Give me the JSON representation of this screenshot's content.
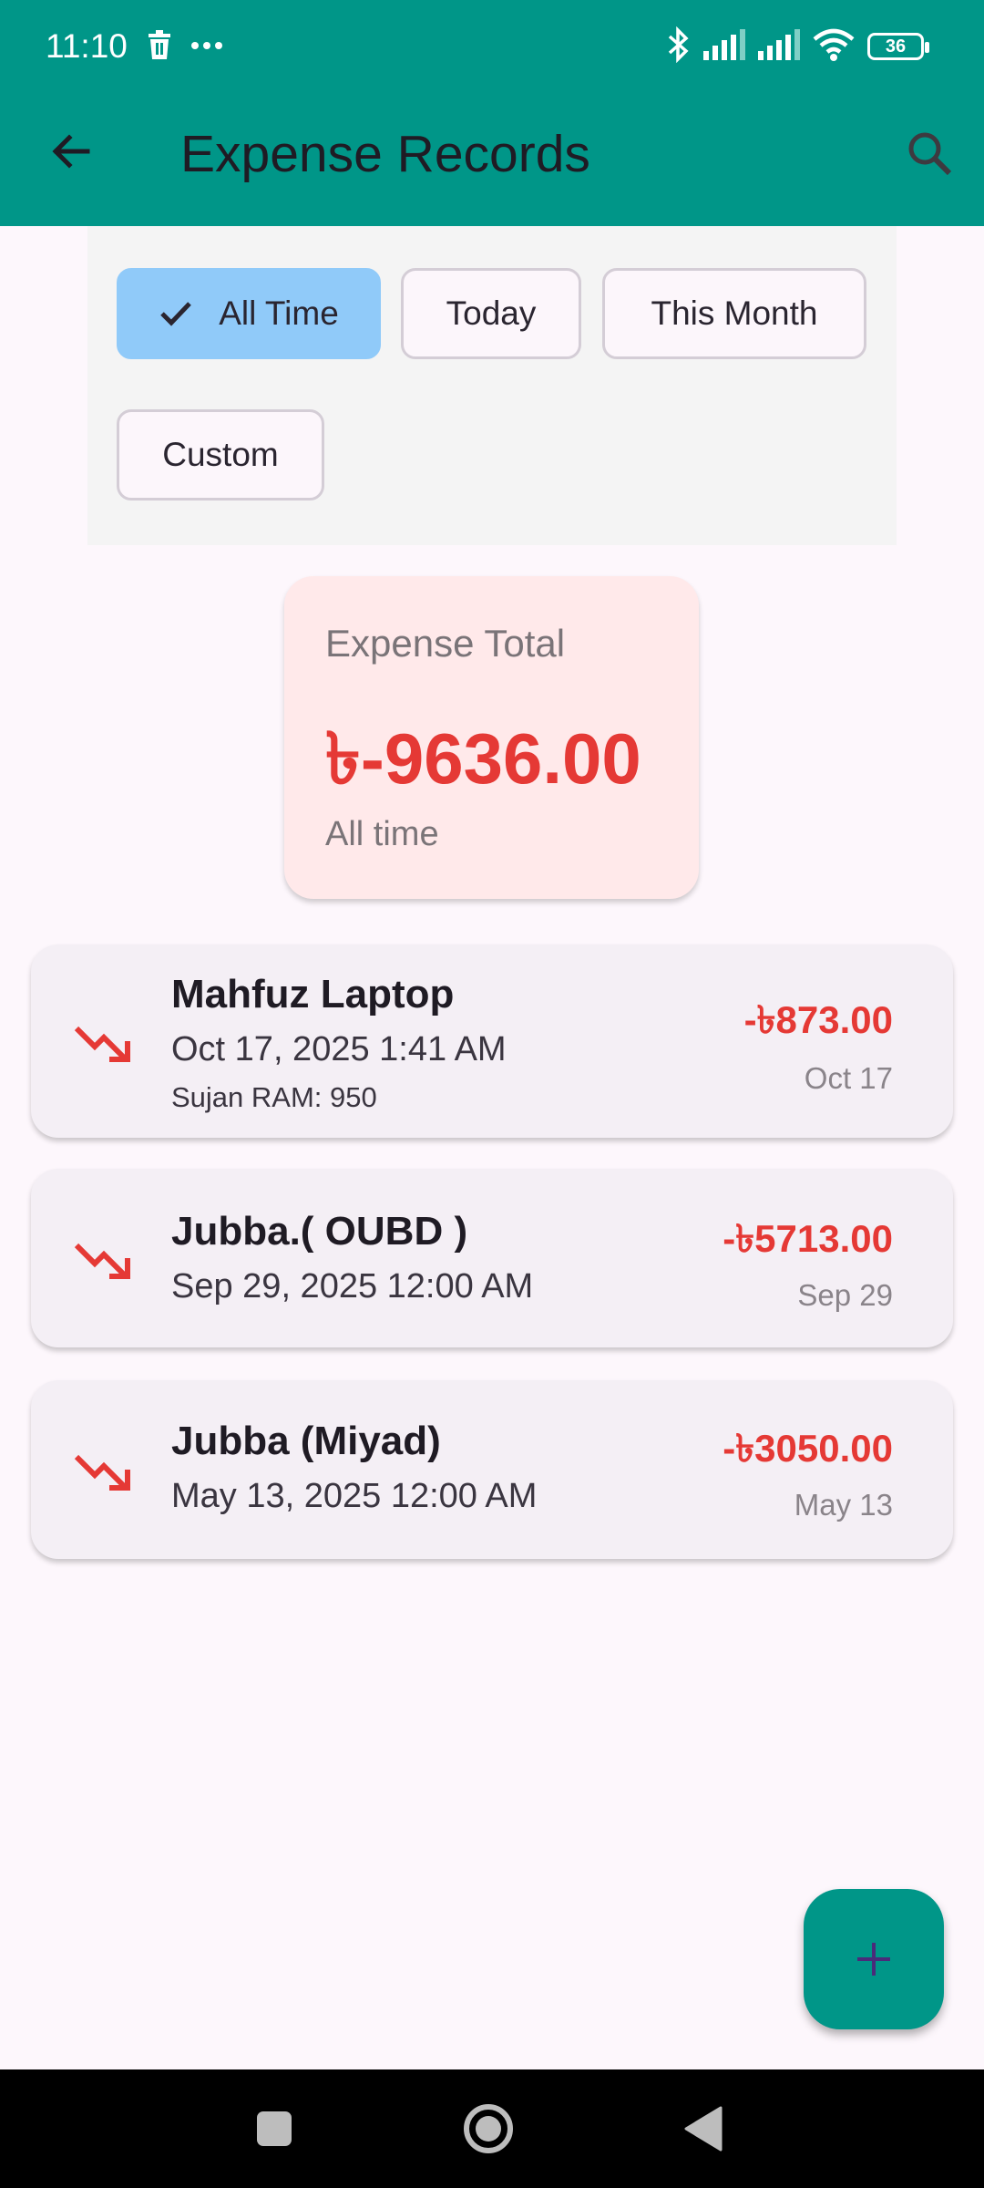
{
  "status_bar": {
    "time": "11:10",
    "battery": "36",
    "icons": [
      "trash-icon",
      "more-icon",
      "bluetooth-icon",
      "signal-icon",
      "signal-icon",
      "wifi-icon",
      "battery-icon"
    ]
  },
  "app_bar": {
    "title": "Expense Records",
    "back_icon": "arrow-back-icon",
    "search_icon": "search-icon",
    "color": "#009688"
  },
  "filters": {
    "chips": [
      {
        "label": "All Time",
        "selected": true
      },
      {
        "label": "Today",
        "selected": false
      },
      {
        "label": "This Month",
        "selected": false
      },
      {
        "label": "Custom",
        "selected": false
      }
    ],
    "selected_color": "#90caf9"
  },
  "summary": {
    "label": "Expense Total",
    "amount": "৳-9636.00",
    "period": "All time",
    "accent": "#e53935"
  },
  "records": [
    {
      "title": "Mahfuz Laptop",
      "datetime": "Oct 17, 2025 1:41 AM",
      "note": "Sujan RAM: 950",
      "amount": "-৳873.00",
      "short_date": "Oct 17",
      "icon": "trending-down-icon"
    },
    {
      "title": "Jubba.( OUBD )",
      "datetime": "Sep 29, 2025 12:00 AM",
      "amount": "-৳5713.00",
      "short_date": "Sep 29",
      "icon": "trending-down-icon"
    },
    {
      "title": "Jubba (Miyad)",
      "datetime": "May 13, 2025 12:00 AM",
      "amount": "-৳3050.00",
      "short_date": "May 13",
      "icon": "trending-down-icon"
    }
  ],
  "fab": {
    "icon": "add-icon"
  },
  "nav_bar": {
    "icons": [
      "recents-square-icon",
      "home-circle-icon",
      "back-triangle-icon"
    ]
  }
}
